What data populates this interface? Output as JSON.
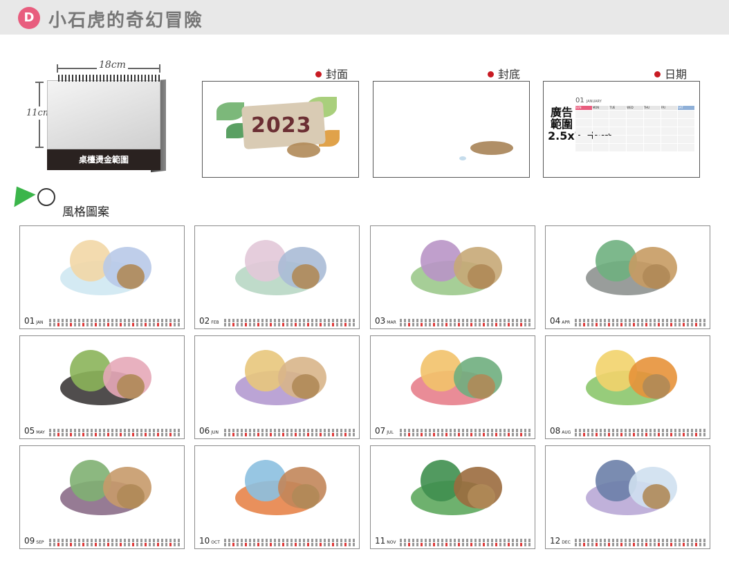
{
  "header": {
    "badge": "D",
    "title": "小石虎的奇幻冒險"
  },
  "desk_calendar": {
    "width_label": "18cm",
    "height_label": "11cm",
    "base_label": "桌檯燙金範圍"
  },
  "previews": [
    {
      "label": "封面",
      "year": "2023"
    },
    {
      "label": "封底"
    },
    {
      "label": "日期",
      "ad_area": "廣告範圍2.5x7.5cm",
      "month": "01",
      "month_name": "JANUARY",
      "weekdays": [
        "SUN",
        "MON",
        "TUE",
        "WED",
        "THU",
        "FRI",
        "SAT"
      ]
    }
  ],
  "style_section": {
    "title": "風格圖案"
  },
  "months": [
    {
      "num": "01",
      "abbr": "JAN"
    },
    {
      "num": "02",
      "abbr": "FEB"
    },
    {
      "num": "03",
      "abbr": "MAR"
    },
    {
      "num": "04",
      "abbr": "APR"
    },
    {
      "num": "05",
      "abbr": "MAY"
    },
    {
      "num": "06",
      "abbr": "JUN"
    },
    {
      "num": "07",
      "abbr": "JUL"
    },
    {
      "num": "08",
      "abbr": "AUG"
    },
    {
      "num": "09",
      "abbr": "SEP"
    },
    {
      "num": "10",
      "abbr": "OCT"
    },
    {
      "num": "11",
      "abbr": "NOV"
    },
    {
      "num": "12",
      "abbr": "DEC"
    }
  ],
  "colors": {
    "badge": "#e85d7e",
    "header_bg": "#e8e8e8",
    "dot": "#c81b23",
    "year_text": "#6b2e33"
  }
}
